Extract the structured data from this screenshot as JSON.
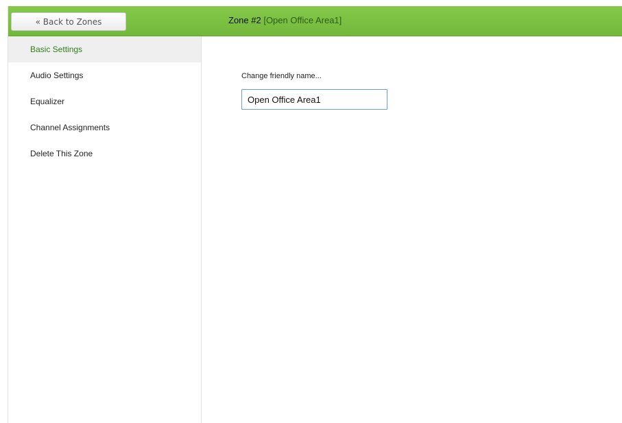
{
  "header": {
    "back_label": "« Back to Zones",
    "zone_number": "Zone #2",
    "zone_name": "[Open Office Area1]"
  },
  "sidebar": {
    "items": [
      {
        "label": "Basic Settings",
        "active": true
      },
      {
        "label": "Audio Settings",
        "active": false
      },
      {
        "label": "Equalizer",
        "active": false
      },
      {
        "label": "Channel Assignments",
        "active": false
      },
      {
        "label": "Delete This Zone",
        "active": false
      }
    ]
  },
  "main": {
    "friendly_name_label": "Change friendly name...",
    "friendly_name_value": "Open Office Area1"
  },
  "colors": {
    "header_green": "#7ac143",
    "active_text": "#2e7d1a",
    "input_border": "#6a9fd6"
  }
}
